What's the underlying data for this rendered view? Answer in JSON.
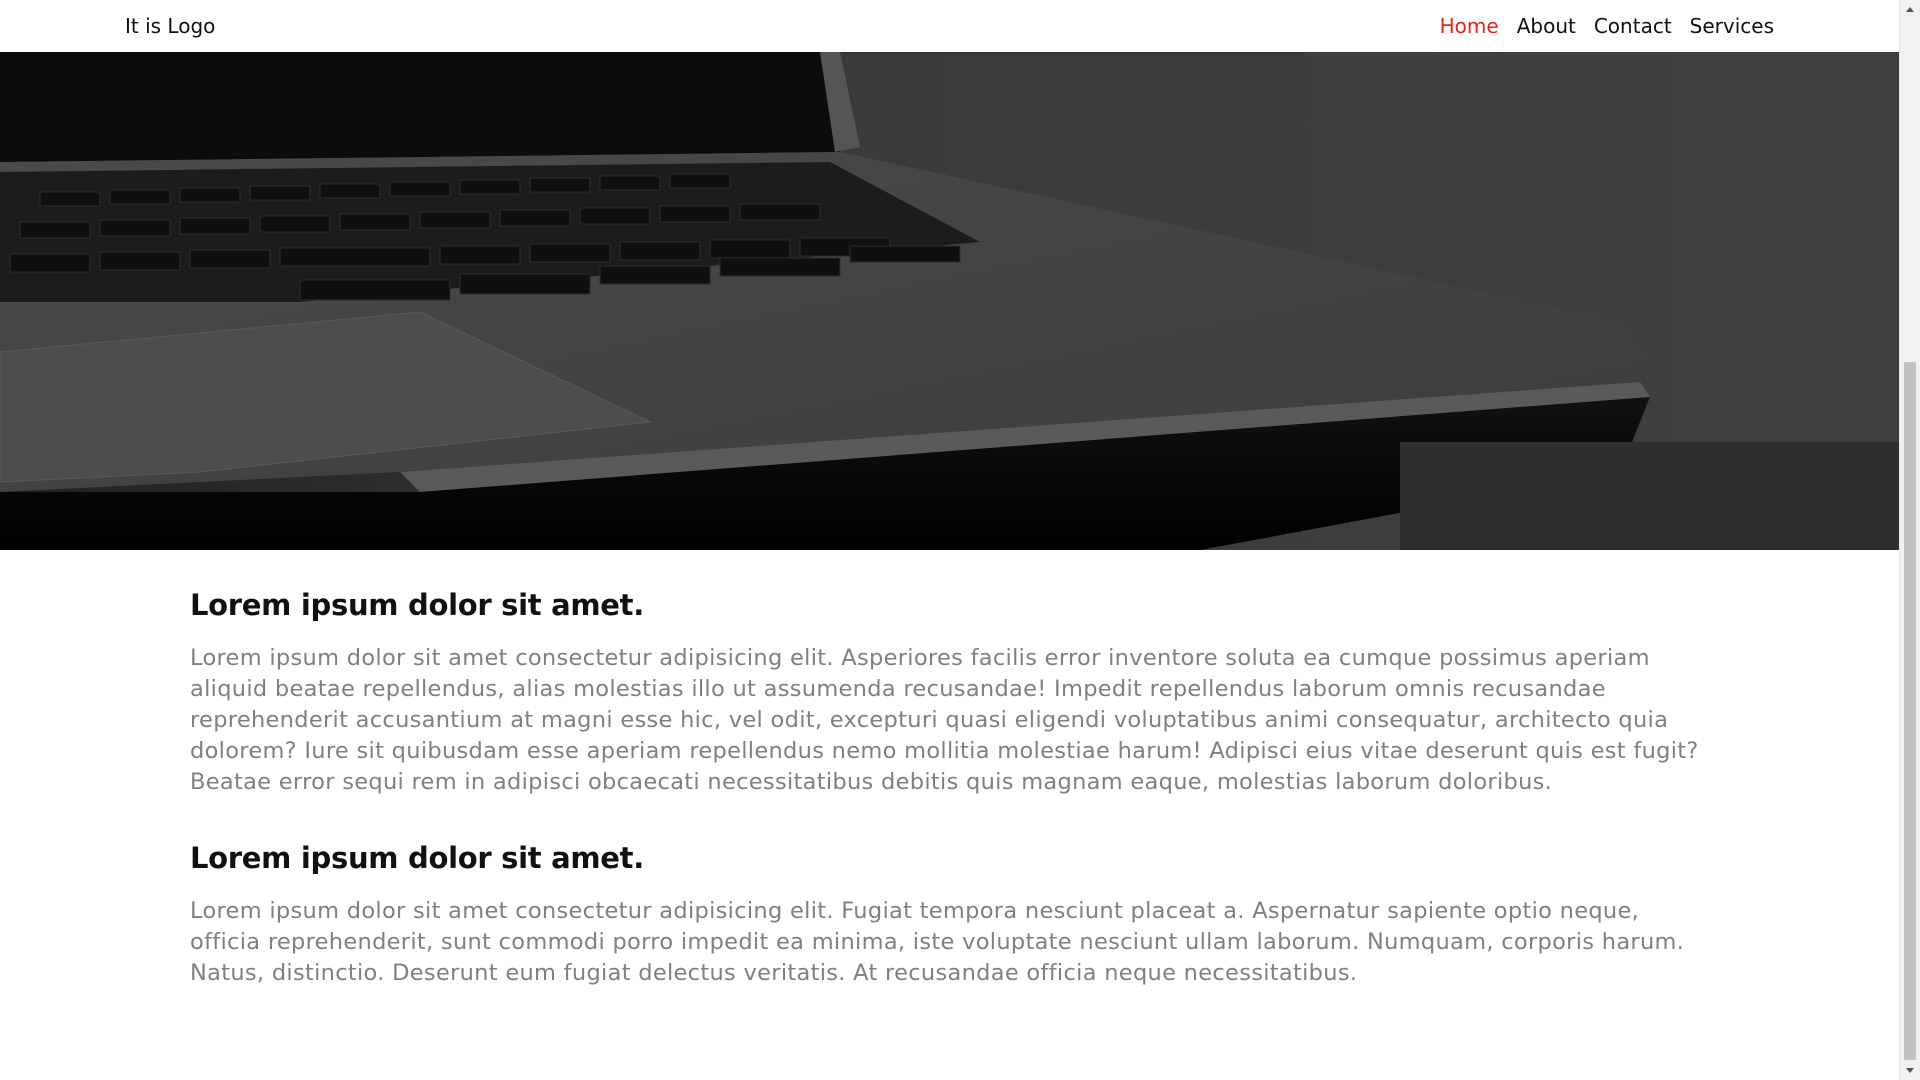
{
  "navbar": {
    "logo": "It is Logo",
    "links": [
      {
        "label": "Home",
        "active": true
      },
      {
        "label": "About",
        "active": false
      },
      {
        "label": "Contact",
        "active": false
      },
      {
        "label": "Services",
        "active": false
      }
    ],
    "active_color": "#e3231f"
  },
  "hero": {
    "image": "laptop-keyboard-image"
  },
  "sections": [
    {
      "heading": "Lorem ipsum dolor sit amet.",
      "body": "Lorem ipsum dolor sit amet consectetur adipisicing elit. Asperiores facilis error inventore soluta ea cumque possimus aperiam aliquid beatae repellendus, alias molestias illo ut assumenda recusandae! Impedit repellendus laborum omnis recusandae reprehenderit accusantium at magni esse hic, vel odit, excepturi quasi eligendi voluptatibus animi consequatur, architecto quia dolorem? Iure sit quibusdam esse aperiam repellendus nemo mollitia molestiae harum! Adipisci eius vitae deserunt quis est fugit? Beatae error sequi rem in adipisci obcaecati necessitatibus debitis quis magnam eaque, molestias laborum doloribus."
    },
    {
      "heading": "Lorem ipsum dolor sit amet.",
      "body": "Lorem ipsum dolor sit amet consectetur adipisicing elit. Fugiat tempora nesciunt placeat a. Aspernatur sapiente optio neque, officia reprehenderit, sunt commodi porro impedit ea minima, iste voluptate nesciunt ullam laborum. Numquam, corporis harum. Natus, distinctio. Deserunt eum fugiat delectus veritatis. At recusandae officia neque necessitatibus."
    }
  ]
}
